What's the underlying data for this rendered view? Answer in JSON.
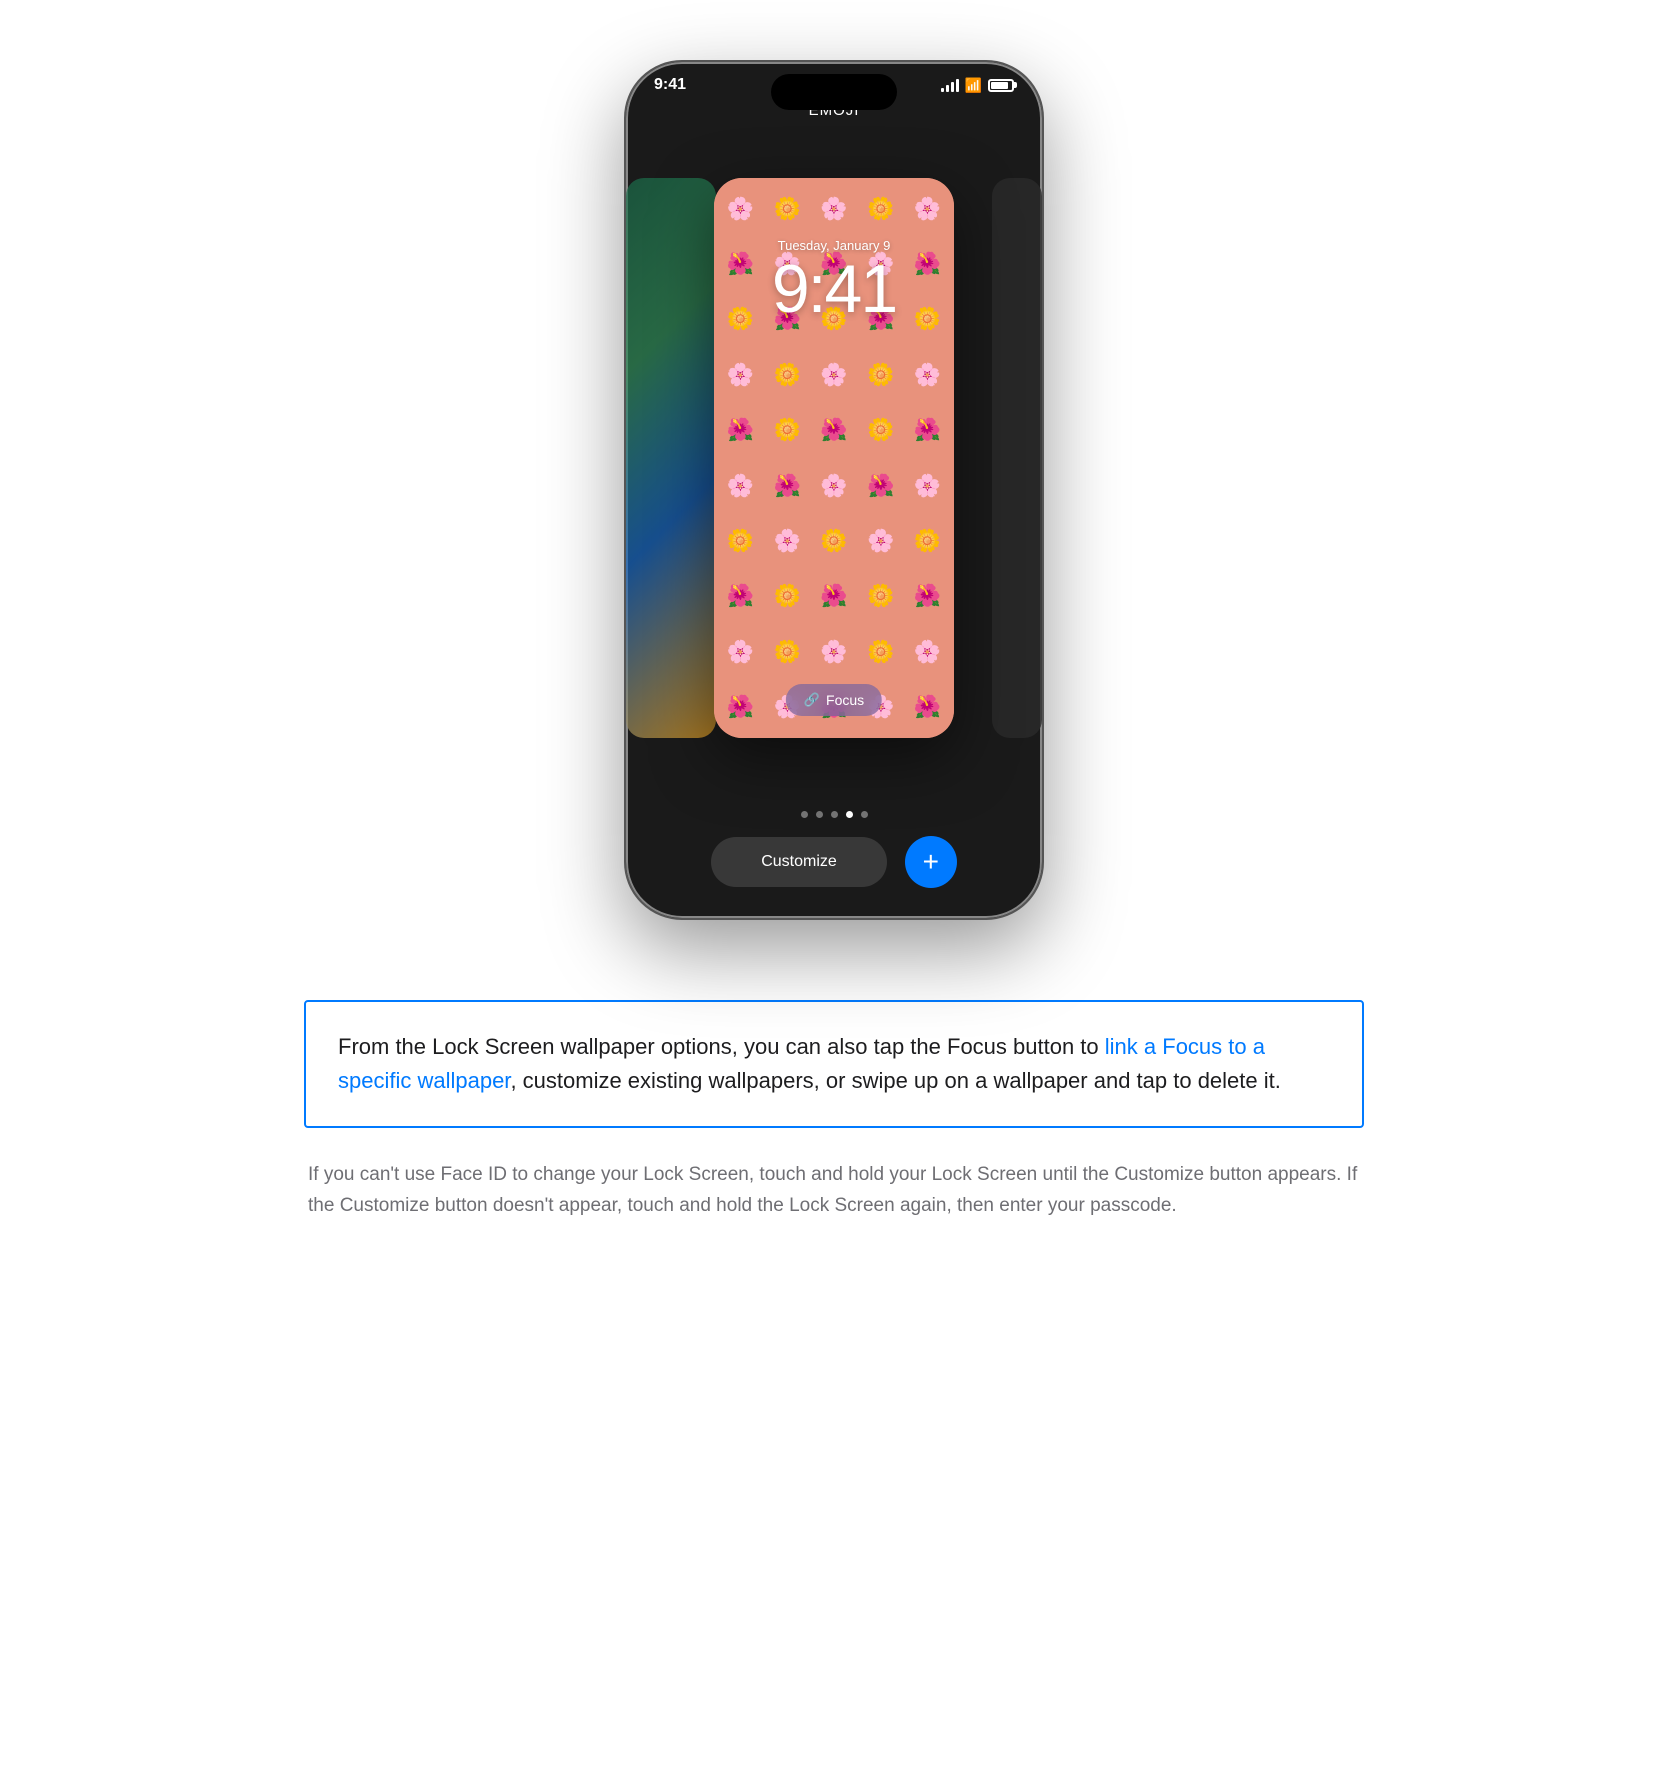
{
  "phone": {
    "status_bar": {
      "time": "9:41",
      "signal_bars": [
        3,
        6,
        9,
        12,
        14
      ],
      "wifi": "wifi",
      "battery": "battery"
    },
    "wallpaper_label": "EMOJI",
    "clock": {
      "date": "Tuesday, January 9",
      "time": "9:41"
    },
    "focus_button": {
      "icon": "🔗",
      "label": "Focus"
    },
    "pagination": {
      "dots": [
        false,
        false,
        false,
        true,
        false
      ],
      "active_index": 3
    },
    "customize_label": "Customize",
    "add_icon": "+",
    "emoji_pattern": [
      "🌸",
      "🌼",
      "🌸",
      "🌼",
      "🌸",
      "🌺",
      "🌸",
      "🌺",
      "🌸",
      "🌺",
      "🌼",
      "🌺",
      "🌼",
      "🌺",
      "🌼",
      "🌸",
      "🌼",
      "🌸",
      "🌼",
      "🌸",
      "🌺",
      "🌼",
      "🌺",
      "🌼",
      "🌺",
      "🌸",
      "🌺",
      "🌸",
      "🌺",
      "🌸",
      "🌼",
      "🌸",
      "🌼",
      "🌸",
      "🌼",
      "🌺",
      "🌼",
      "🌺",
      "🌼",
      "🌺",
      "🌸",
      "🌼",
      "🌸",
      "🌼",
      "🌸",
      "🌺",
      "🌸",
      "🌺",
      "🌸",
      "🌺"
    ]
  },
  "content": {
    "highlight_paragraph": {
      "before_link": "From the Lock Screen wallpaper options, you can also tap the Focus button to ",
      "link_text": "link a Focus to a specific wallpaper",
      "after_link": ", customize existing wallpapers, or swipe up on a wallpaper and tap to delete it."
    },
    "secondary_paragraph": "If you can't use Face ID to change your Lock Screen, touch and hold your Lock Screen until the Customize button appears. If the Customize button doesn't appear, touch and hold the Lock Screen again, then enter your passcode."
  }
}
